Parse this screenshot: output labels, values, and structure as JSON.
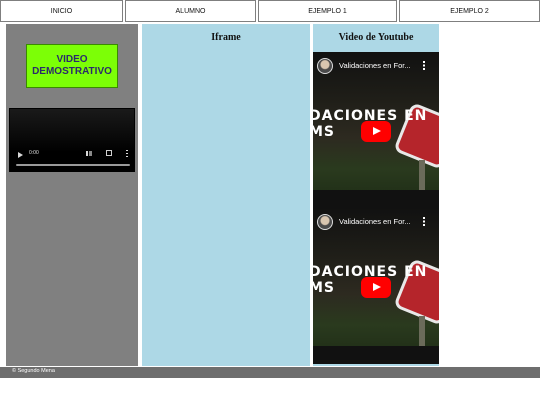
{
  "nav": {
    "items": [
      {
        "label": "INICIO"
      },
      {
        "label": "ALUMNO"
      },
      {
        "label": "EJEMPLO 1"
      },
      {
        "label": "EJEMPLO 2"
      }
    ]
  },
  "left_panel": {
    "demo_label": "VIDEO DEMOSTRATIVO",
    "player": {
      "time": "0:00"
    }
  },
  "iframe_panel": {
    "title": "Iframe"
  },
  "youtube_panel": {
    "title": "Video de Youtube",
    "embeds": [
      {
        "video_title": "Validaciones en For...",
        "overlay_text": "DACIONES EN\nMS"
      },
      {
        "video_title": "Validaciones en For...",
        "overlay_text": "DACIONES EN\nMS"
      }
    ]
  },
  "footer": {
    "text": "© Segundo Mena"
  },
  "colors": {
    "left_panel_bg": "#808080",
    "panel_bg": "#add8e6",
    "demo_button_bg": "#7cff06",
    "youtube_red": "#ff0000",
    "footer_bg": "#6e6e6e"
  }
}
